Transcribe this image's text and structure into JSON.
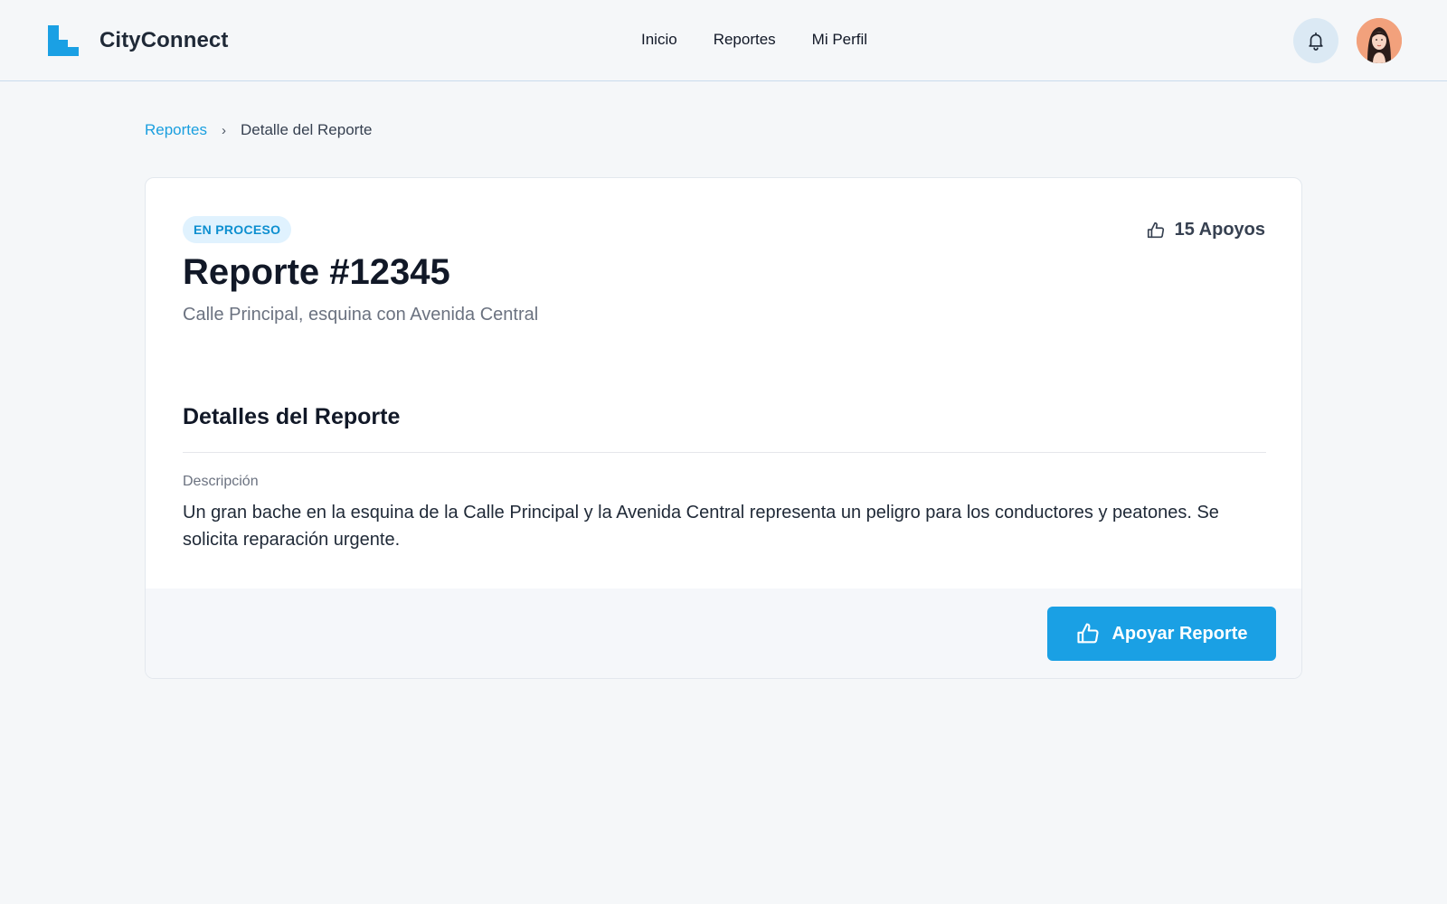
{
  "app": {
    "name": "CityConnect",
    "brand_color": "#1aa0e4"
  },
  "nav": {
    "items": [
      {
        "label": "Inicio"
      },
      {
        "label": "Reportes"
      },
      {
        "label": "Mi Perfil"
      }
    ]
  },
  "header_icons": {
    "notifications": "bell-icon",
    "avatar": "user-avatar"
  },
  "breadcrumb": {
    "parent": "Reportes",
    "current": "Detalle del Reporte"
  },
  "report": {
    "status": "EN PROCESO",
    "supports_label": "15 Apoyos",
    "title": "Reporte #12345",
    "address": "Calle Principal, esquina con Avenida Central",
    "section_title": "Detalles del Reporte",
    "description_label": "Descripción",
    "description": "Un gran bache en la esquina de la Calle Principal y la Avenida Central representa un peligro para los conductores y peatones. Se solicita reparación urgente."
  },
  "actions": {
    "support_button": "Apoyar Reporte"
  }
}
